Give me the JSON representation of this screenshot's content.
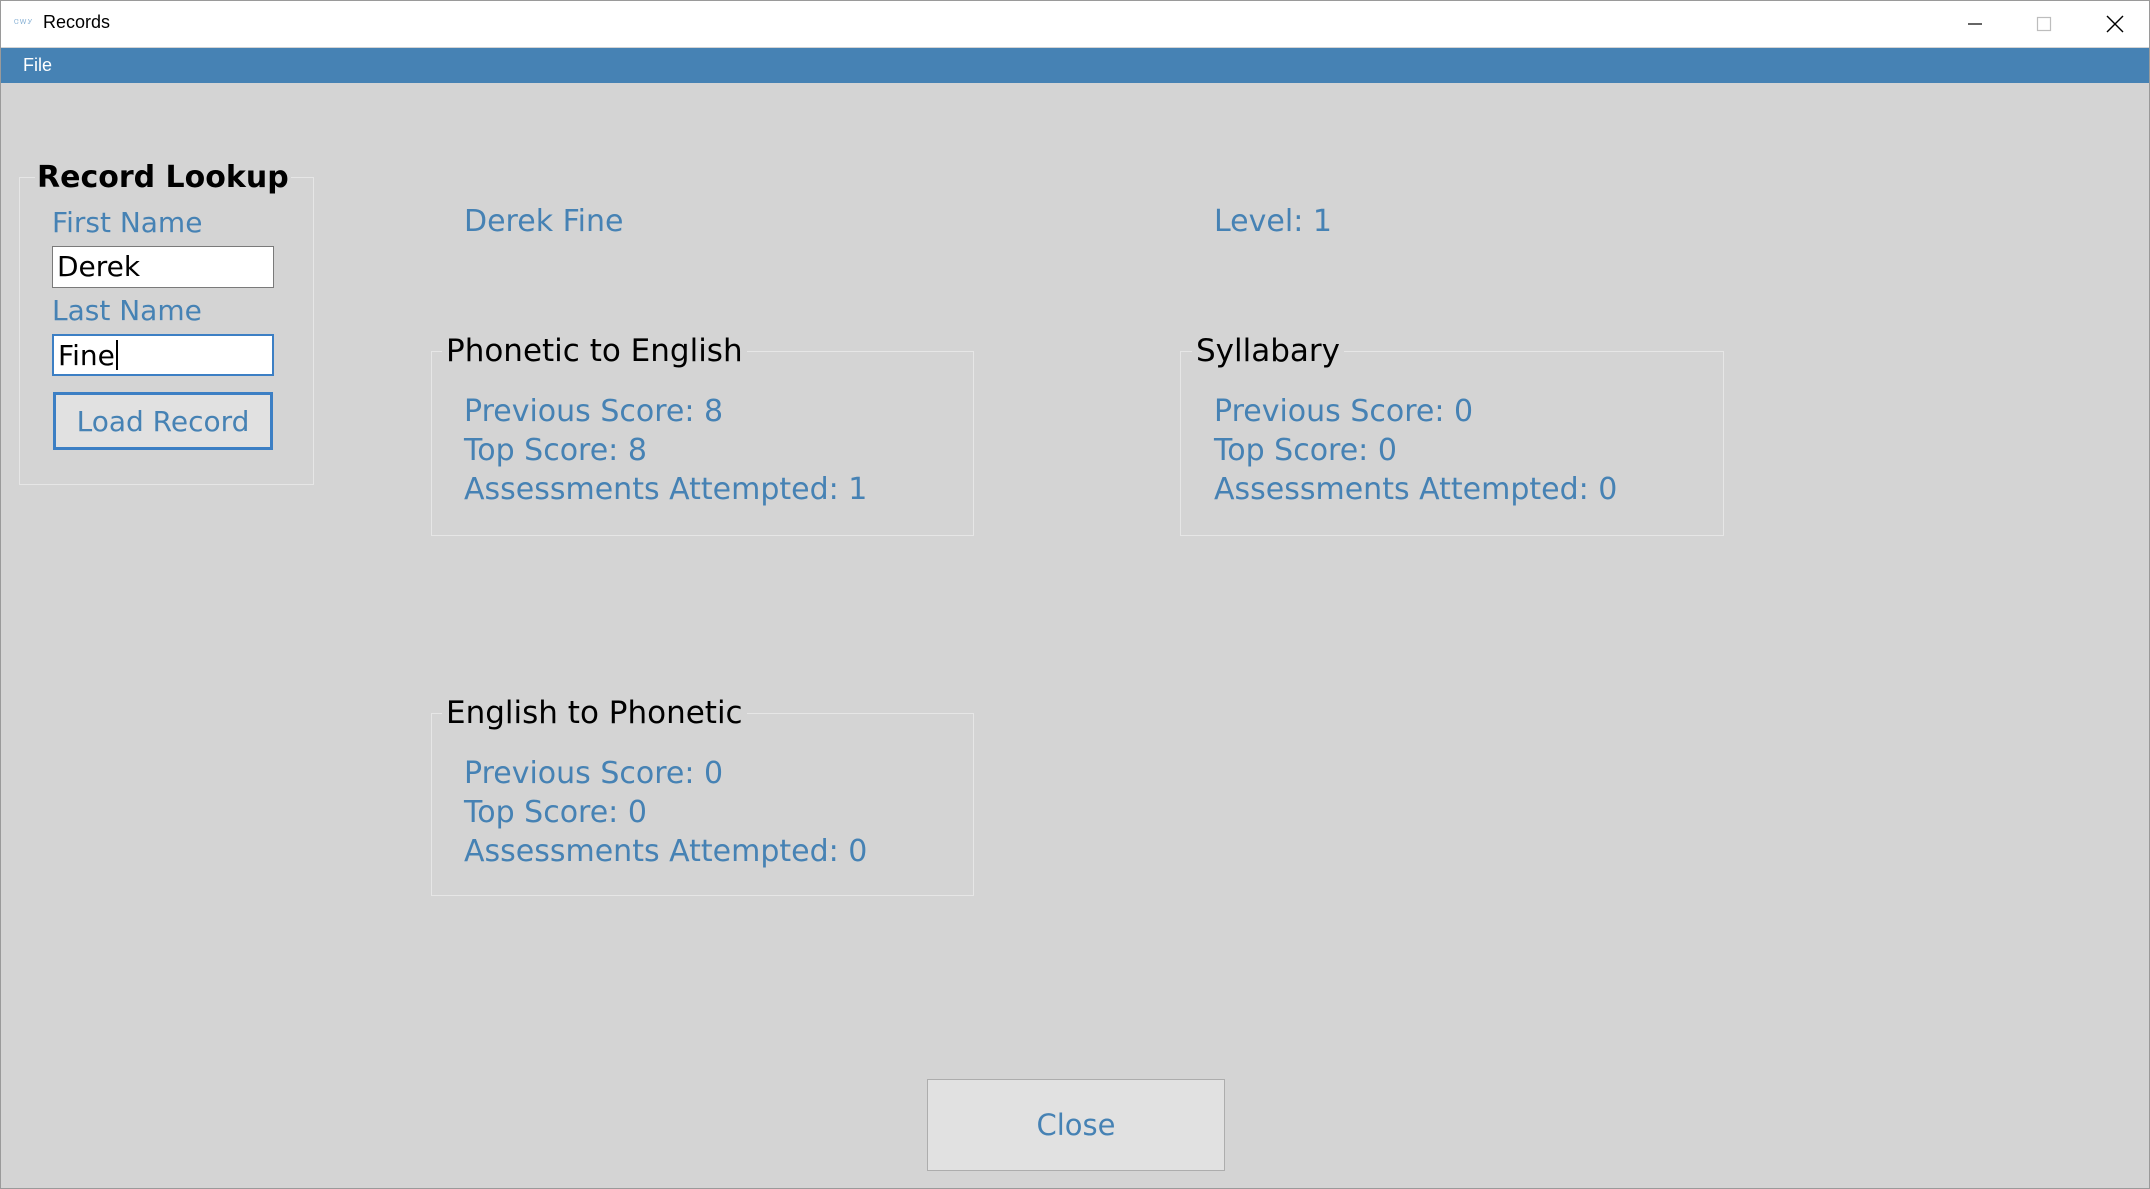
{
  "window": {
    "title": "Records",
    "app_icon_text": "ᏣᎳᎩ",
    "minimize_icon": "minimize-icon",
    "maximize_icon": "maximize-icon",
    "close_icon": "close-icon"
  },
  "menu": {
    "file_label": "File"
  },
  "lookup": {
    "group_title": "Record Lookup",
    "first_name_label": "First Name",
    "first_name_value": "Derek",
    "last_name_label": "Last Name",
    "last_name_value": "Fine",
    "load_button": "Load Record"
  },
  "record": {
    "student_name": "Derek Fine",
    "level": "Level: 1"
  },
  "sections": {
    "phonetic_to_english": {
      "title": "Phonetic to English",
      "previous_score": "Previous Score: 8",
      "top_score": "Top Score: 8",
      "assessments_attempted": "Assessments Attempted: 1"
    },
    "syllabary": {
      "title": "Syllabary",
      "previous_score": "Previous Score: 0",
      "top_score": "Top Score: 0",
      "assessments_attempted": "Assessments Attempted: 0"
    },
    "english_to_phonetic": {
      "title": "English to Phonetic",
      "previous_score": "Previous Score: 0",
      "top_score": "Top Score: 0",
      "assessments_attempted": "Assessments Attempted: 0"
    }
  },
  "footer": {
    "close_button": "Close"
  },
  "colors": {
    "accent": "#4682b4",
    "background": "#d4d4d4",
    "focus_border": "#3c7fc4"
  }
}
